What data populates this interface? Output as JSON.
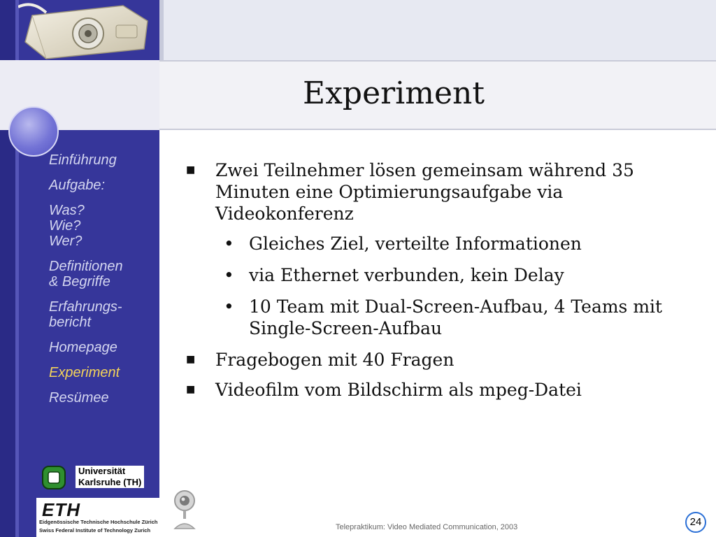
{
  "slide": {
    "title": "Experiment",
    "footer": "Telepraktikum: Video Mediated Communication, 2003",
    "page_number": "24"
  },
  "nav": {
    "items": [
      {
        "label": "Einführung",
        "active": false
      },
      {
        "label": "Aufgabe:",
        "active": false
      },
      {
        "label": "Was?\nWie?\nWer?",
        "active": false
      },
      {
        "label": "Definitionen\n& Begriffe",
        "active": false
      },
      {
        "label": "Erfahrungs-\nbericht",
        "active": false
      },
      {
        "label": "Homepage",
        "active": false
      },
      {
        "label": "Experiment",
        "active": true
      },
      {
        "label": "Resümee",
        "active": false
      }
    ]
  },
  "content": {
    "bullets": [
      {
        "level": 1,
        "marker": "■",
        "text": "Zwei Teilnehmer lösen gemeinsam während 35 Minuten eine Optimierungsaufgabe via Videokonferenz"
      },
      {
        "level": 2,
        "marker": "•",
        "text": "Gleiches Ziel, verteilte Informationen"
      },
      {
        "level": 2,
        "marker": "•",
        "text": "via Ethernet verbunden, kein Delay"
      },
      {
        "level": 2,
        "marker": "•",
        "text": "10 Team mit Dual-Screen-Aufbau, 4 Teams mit Single-Screen-Aufbau"
      },
      {
        "level": 1,
        "marker": "■",
        "text": "Fragebogen mit 40 Fragen"
      },
      {
        "level": 1,
        "marker": "■",
        "text": "Videofilm vom Bildschirm als mpeg-Datei"
      }
    ]
  },
  "logos": {
    "university_line1": "Universität",
    "university_line2": "Karlsruhe (TH)",
    "eth_mark": "ETH",
    "eth_line1": "Eidgenössische Technische Hochschule Zürich",
    "eth_line2": "Swiss Federal Institute of Technology Zurich"
  },
  "icons": {
    "projector": "projector-icon",
    "webcam": "webcam-icon",
    "university_logo": "university-logo-icon"
  },
  "colors": {
    "nav_band": "#36369a",
    "nav_text": "#d4d6f0",
    "nav_active": "#f4d35a",
    "page_badge_border": "#2a6fd6"
  }
}
